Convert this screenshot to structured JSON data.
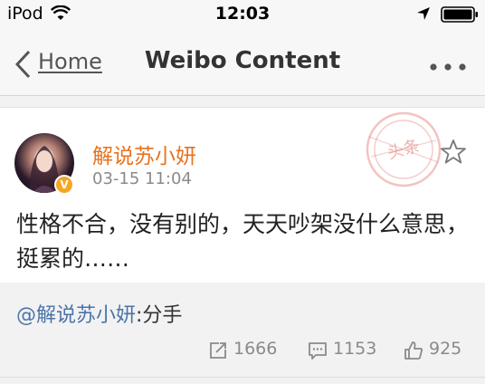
{
  "status_bar": {
    "carrier": "iPod",
    "time": "12:03"
  },
  "nav": {
    "back_label": "Home",
    "title": "Weibo Content"
  },
  "post": {
    "username": "解说苏小妍",
    "timestamp": "03-15 11:04",
    "content": "性格不合，没有别的，天天吵架没什么意思，挺累的……",
    "stamp_text": "头条",
    "verified_badge": "V"
  },
  "repost": {
    "mention": "@解说苏小妍",
    "text": ":分手"
  },
  "actions": {
    "repost_count": "1666",
    "comment_count": "1153",
    "like_count": "925"
  },
  "colors": {
    "accent_orange": "#e8721e",
    "link_blue": "#4a74a8",
    "muted_gray": "#8a8a8a",
    "stamp_red": "#d9534f"
  },
  "icons": [
    "wifi-icon",
    "location-arrow-icon",
    "battery-icon",
    "back-chevron-icon",
    "more-icon",
    "star-icon",
    "repost-icon",
    "comment-icon",
    "like-icon",
    "verified-badge-icon"
  ]
}
